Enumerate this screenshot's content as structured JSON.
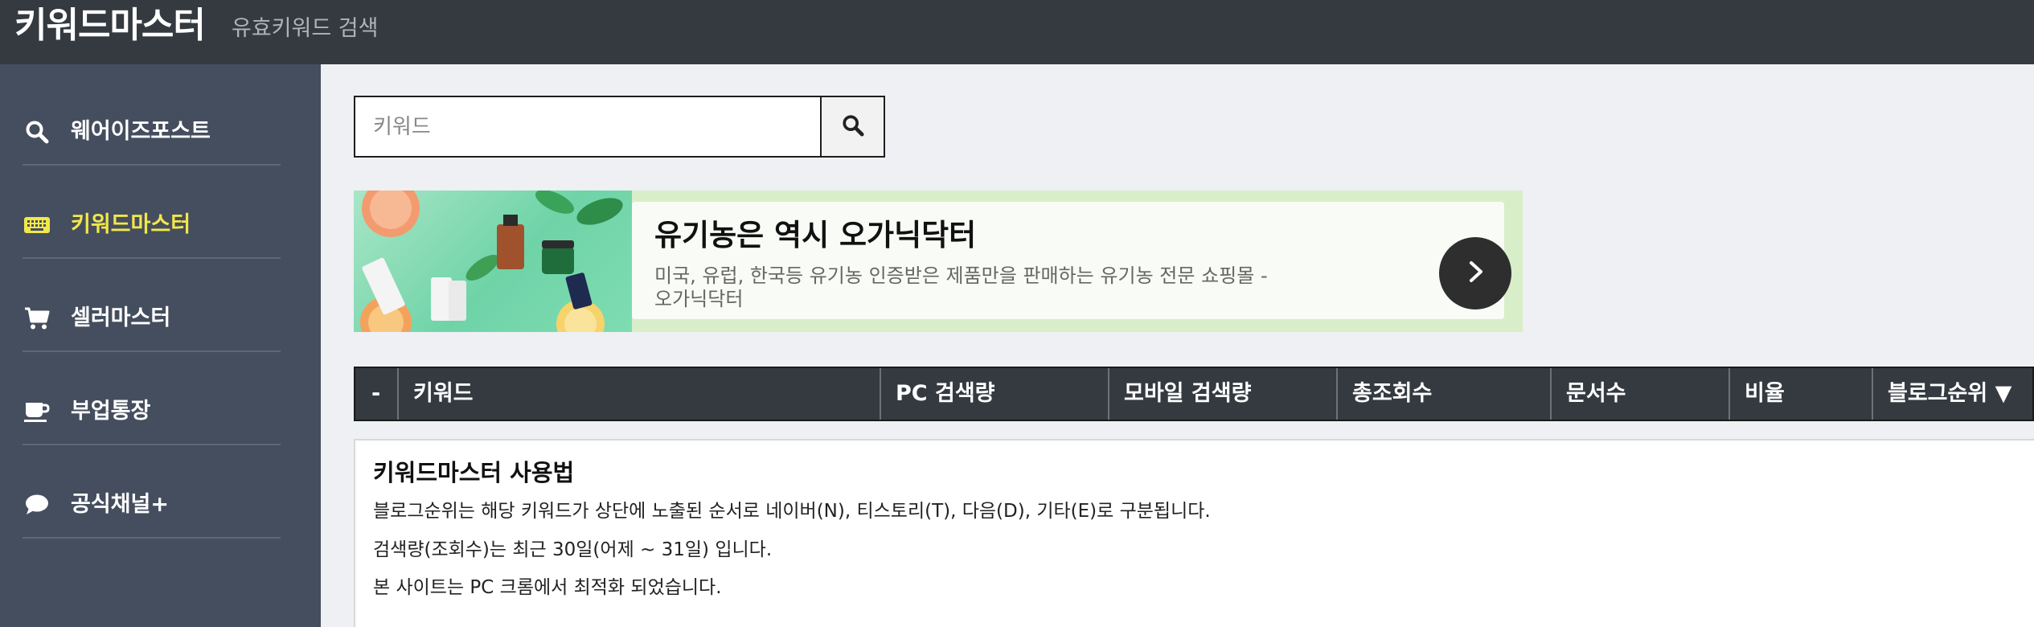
{
  "header": {
    "brand": "키워드마스터",
    "subtitle": "유효키워드 검색"
  },
  "sidebar": {
    "items": [
      {
        "label": "웨어이즈포스트",
        "icon": "search-icon"
      },
      {
        "label": "키워드마스터",
        "icon": "keyboard-icon",
        "active": true
      },
      {
        "label": "셀러마스터",
        "icon": "cart-icon"
      },
      {
        "label": "부업통장",
        "icon": "coffee-cup-icon"
      },
      {
        "label": "공식채널+",
        "icon": "chat-bubble-icon"
      }
    ],
    "active_color": "#f2e74a"
  },
  "search": {
    "placeholder": "키워드",
    "value": ""
  },
  "ad": {
    "title": "유기농은 역시 오가닉닥터",
    "description": "미국, 유럽, 한국등 유기농 인증받은 제품만을 판매하는 유기농 전문 쇼핑몰 - 오가닉닥터"
  },
  "table": {
    "columns": [
      "-",
      "키워드",
      "PC 검색량",
      "모바일 검색량",
      "총조회수",
      "문서수",
      "비율",
      "블로그순위 ▼"
    ]
  },
  "info": {
    "title": "키워드마스터 사용법",
    "lines": [
      "블로그순위는 해당 키워드가 상단에 노출된 순서로 네이버(N), 티스토리(T), 다음(D), 기타(E)로 구분됩니다.",
      "검색량(조회수)는 최근 30일(어제 ~ 31일) 입니다.",
      "본 사이트는 PC 크롬에서 최적화 되었습니다."
    ]
  },
  "colors": {
    "header_bg": "#343a40",
    "sidebar_bg": "#454e5e",
    "page_bg": "#eef0f3",
    "ad_bg": "#d8eec9"
  }
}
